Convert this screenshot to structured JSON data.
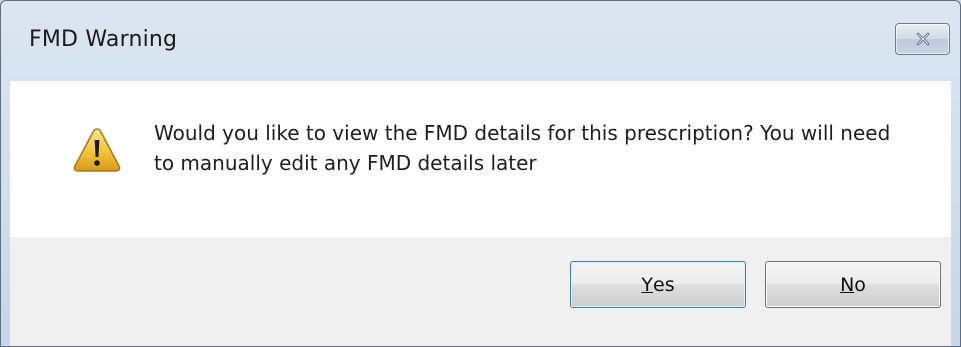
{
  "dialog": {
    "title": "FMD Warning",
    "message": "Would you like to view the FMD details for this prescription? You will need to manually edit any FMD details later",
    "icon": "warning-icon",
    "buttons": {
      "yes": {
        "mnemonic": "Y",
        "rest": "es"
      },
      "no": {
        "mnemonic": "N",
        "rest": "o"
      }
    }
  },
  "colors": {
    "titlebar": "#dce6f2",
    "content_bg": "#ffffff",
    "footer_bg": "#f0f0f0",
    "warning_yellow": "#f3c33a"
  }
}
